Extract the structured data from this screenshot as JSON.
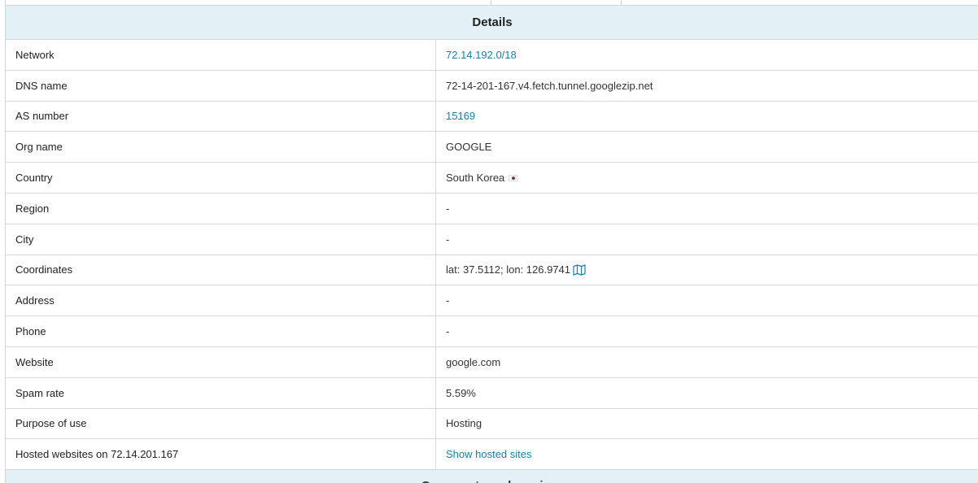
{
  "section": {
    "title": "Details",
    "next_title": "Open ports and services"
  },
  "rows": [
    {
      "label": "Network",
      "value": "72.14.192.0/18",
      "type": "link"
    },
    {
      "label": "DNS name",
      "value": "72-14-201-167.v4.fetch.tunnel.googlezip.net",
      "type": "text"
    },
    {
      "label": "AS number",
      "value": "15169",
      "type": "link"
    },
    {
      "label": "Org name",
      "value": "GOOGLE",
      "type": "text"
    },
    {
      "label": "Country",
      "value": "South Korea",
      "type": "text",
      "icon": "south-korea-flag-icon"
    },
    {
      "label": "Region",
      "value": "-",
      "type": "text"
    },
    {
      "label": "City",
      "value": "-",
      "type": "text"
    },
    {
      "label": "Coordinates",
      "value": "lat: 37.5112; lon: 126.9741",
      "type": "text",
      "icon": "map-icon"
    },
    {
      "label": "Address",
      "value": "-",
      "type": "text"
    },
    {
      "label": "Phone",
      "value": "-",
      "type": "text"
    },
    {
      "label": "Website",
      "value": "google.com",
      "type": "text"
    },
    {
      "label": "Spam rate",
      "value": "5.59%",
      "type": "text"
    },
    {
      "label": "Purpose of use",
      "value": "Hosting",
      "type": "text"
    },
    {
      "label": "Hosted websites on 72.14.201.167",
      "value": "Show hosted sites",
      "type": "link"
    }
  ],
  "colors": {
    "header_bg": "#e3f0f5",
    "link": "#1a7fa8",
    "border": "#d5dadd"
  }
}
